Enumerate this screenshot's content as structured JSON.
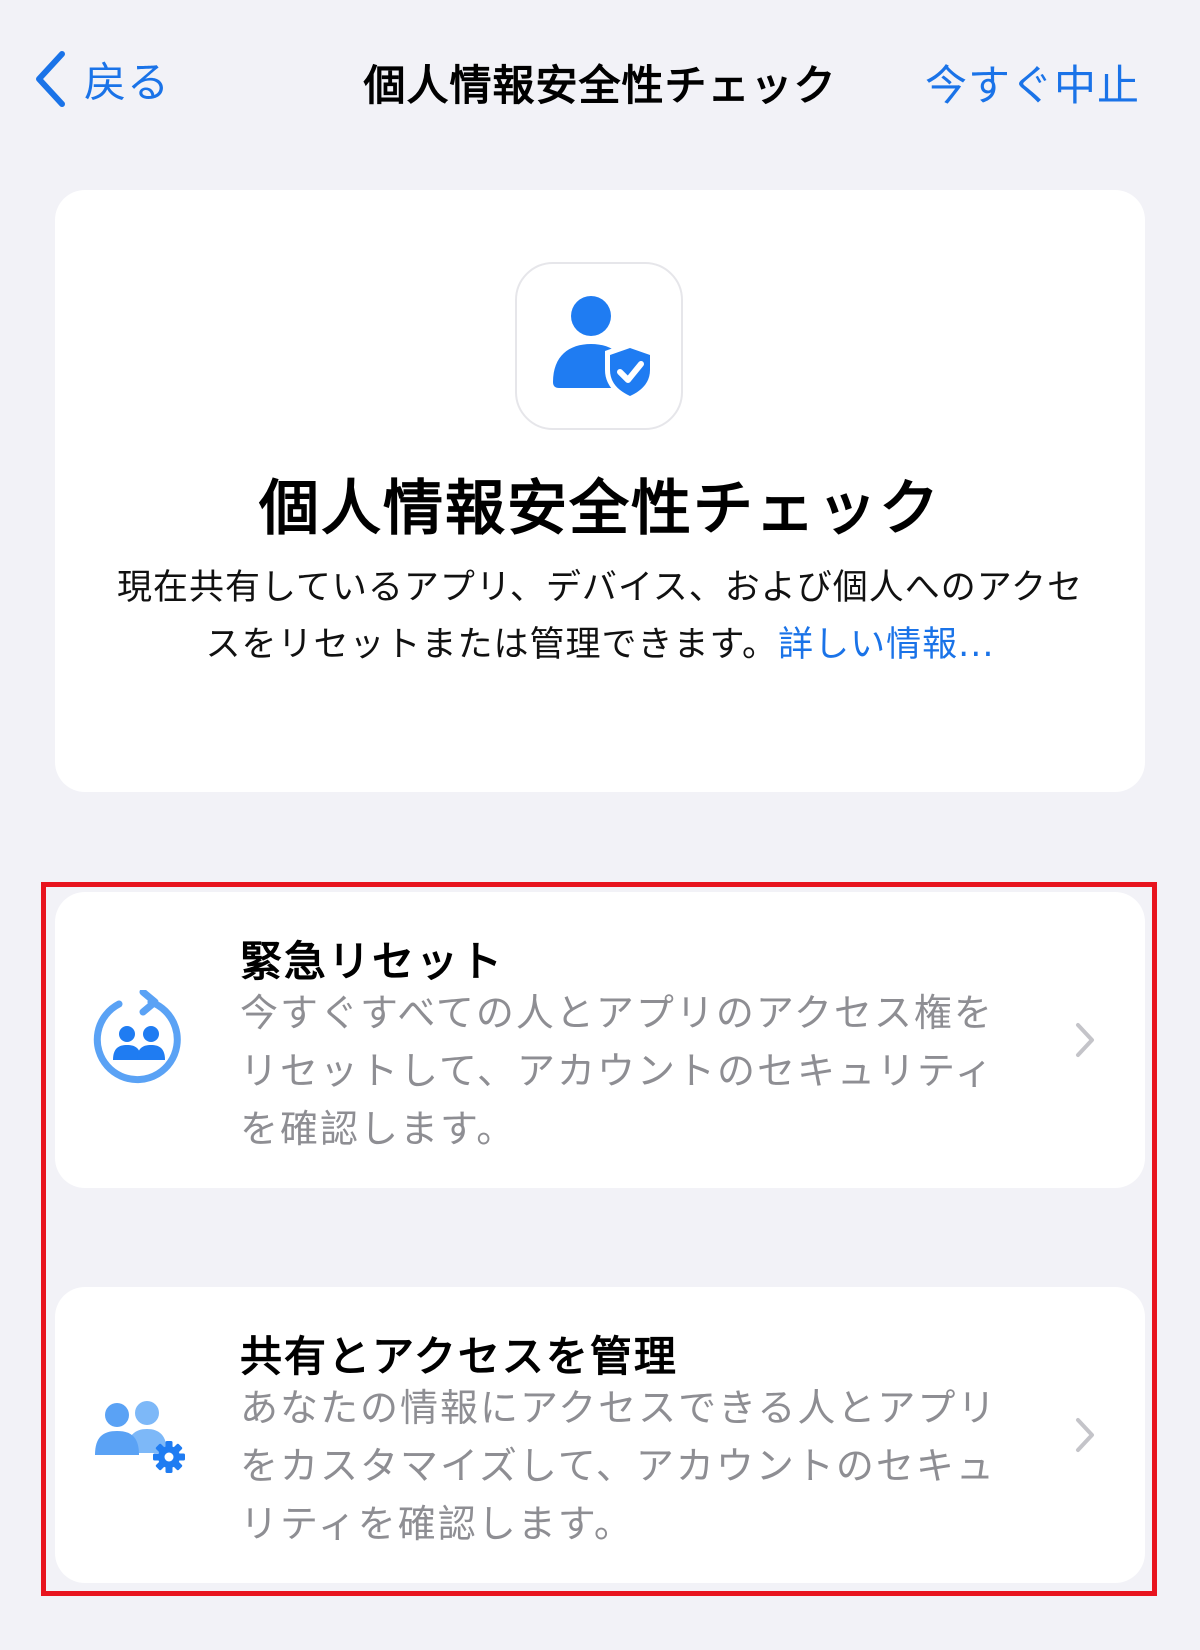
{
  "nav": {
    "back_label": "戻る",
    "title": "個人情報安全性チェック",
    "stop_label": "今すぐ中止"
  },
  "hero": {
    "icon": "person-shield-check-icon",
    "title": "個人情報安全性チェック",
    "description": "現在共有しているアプリ、デバイス、および個人へのアクセスをリセットまたは管理できます。",
    "learn_more": "詳しい情報..."
  },
  "options": [
    {
      "icon": "people-reset-icon",
      "title": "緊急リセット",
      "description": "今すぐすべての人とアプリのアクセス権をリセットして、アカウントのセキュリティを確認します。"
    },
    {
      "icon": "people-gear-icon",
      "title": "共有とアクセスを管理",
      "description": "あなたの情報にアクセスできる人とアプリをカスタマイズして、アカウントのセキュリティを確認します。"
    }
  ],
  "colors": {
    "accent": "#1a73e8",
    "highlight": "#e8141e",
    "secondary_text": "#8e8e93",
    "background": "#f2f2f7"
  }
}
